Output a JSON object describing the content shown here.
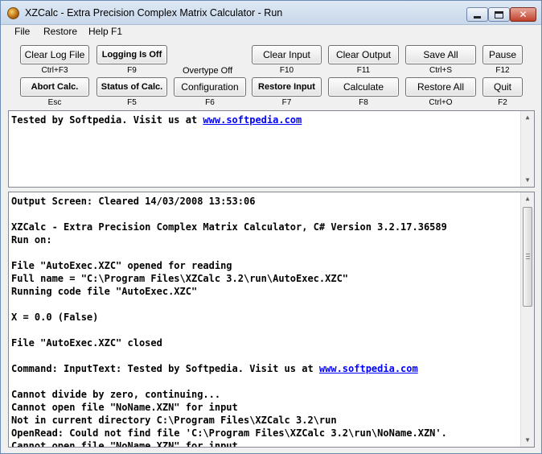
{
  "window": {
    "title": "XZCalc - Extra Precision Complex Matrix Calculator - Run"
  },
  "menu": [
    "File",
    "Restore",
    "Help F1"
  ],
  "buttons": [
    {
      "label": "Clear Log File",
      "hint": "Ctrl+F3"
    },
    {
      "label": "Logging Is Off",
      "hint": "F9"
    },
    {
      "label": "Clear Input",
      "hint": "F10"
    },
    {
      "label": "Clear Output",
      "hint": "F11"
    },
    {
      "label": "Save All",
      "hint": "Ctrl+S"
    },
    {
      "label": "Pause",
      "hint": "F12"
    },
    {
      "label": "Abort Calc.",
      "hint": "Esc"
    },
    {
      "label": "Status of Calc.",
      "hint": "F5"
    },
    {
      "label": "Configuration",
      "hint": "F6"
    },
    {
      "label": "Restore Input",
      "hint": "F7"
    },
    {
      "label": "Calculate",
      "hint": "F8"
    },
    {
      "label": "Restore All",
      "hint": "Ctrl+O"
    },
    {
      "label": "Quit",
      "hint": "F2"
    }
  ],
  "overtype_status": "Overtype Off",
  "input_pane": {
    "text_before_link": "Tested by Softpedia. Visit us at ",
    "link": "www.softpedia.com"
  },
  "output_pane": {
    "lines": [
      "Output Screen: Cleared 14/03/2008 13:53:06",
      "",
      "XZCalc - Extra Precision Complex Matrix Calculator, C# Version 3.2.17.36589",
      "Run on:",
      "",
      "File \"AutoExec.XZC\" opened for reading",
      "Full name = \"C:\\Program Files\\XZCalc 3.2\\run\\AutoExec.XZC\"",
      "Running code file \"AutoExec.XZC\"",
      "",
      "X = 0.0 (False)",
      "",
      "File \"AutoExec.XZC\" closed",
      "",
      "Command: InputText: Tested by Softpedia. Visit us at ",
      "",
      "Cannot divide by zero, continuing...",
      "Cannot open file \"NoName.XZN\" for input",
      "Not in current directory C:\\Program Files\\XZCalc 3.2\\run",
      "OpenRead: Could not find file 'C:\\Program Files\\XZCalc 3.2\\run\\NoName.XZN'.",
      "Cannot open file \"NoName.XZN\" for input"
    ],
    "command_link": "www.softpedia.com"
  },
  "colors": {
    "link": "#0000ff",
    "title_bar": "#c7d7ea"
  },
  "icons": [
    "app-calculator-icon",
    "minimize-icon",
    "maximize-icon",
    "close-icon",
    "scroll-up-icon",
    "scroll-down-icon"
  ]
}
